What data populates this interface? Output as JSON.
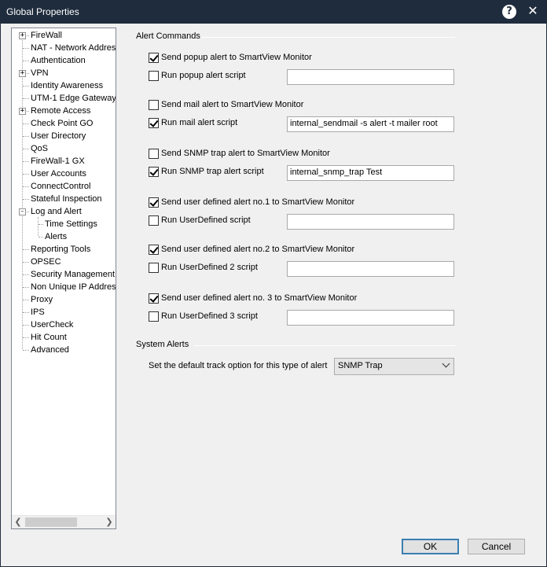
{
  "window": {
    "title": "Global Properties"
  },
  "tree": {
    "items": [
      {
        "label": "FireWall",
        "expander": "+"
      },
      {
        "label": "NAT - Network Address Translation",
        "expander": ""
      },
      {
        "label": "Authentication",
        "expander": ""
      },
      {
        "label": "VPN",
        "expander": "+"
      },
      {
        "label": "Identity Awareness",
        "expander": ""
      },
      {
        "label": "UTM-1 Edge Gateway",
        "expander": ""
      },
      {
        "label": "Remote Access",
        "expander": "+"
      },
      {
        "label": "Check Point GO",
        "expander": ""
      },
      {
        "label": "User Directory",
        "expander": ""
      },
      {
        "label": "QoS",
        "expander": ""
      },
      {
        "label": "FireWall-1 GX",
        "expander": ""
      },
      {
        "label": "User Accounts",
        "expander": ""
      },
      {
        "label": "ConnectControl",
        "expander": ""
      },
      {
        "label": "Stateful Inspection",
        "expander": ""
      },
      {
        "label": "Log and Alert",
        "expander": "-"
      },
      {
        "label": "Time Settings",
        "expander": ""
      },
      {
        "label": "Alerts",
        "expander": ""
      },
      {
        "label": "Reporting Tools",
        "expander": ""
      },
      {
        "label": "OPSEC",
        "expander": ""
      },
      {
        "label": "Security Management Access",
        "expander": ""
      },
      {
        "label": "Non Unique IP Address Ranges",
        "expander": ""
      },
      {
        "label": "Proxy",
        "expander": ""
      },
      {
        "label": "IPS",
        "expander": ""
      },
      {
        "label": "UserCheck",
        "expander": ""
      },
      {
        "label": "Hit Count",
        "expander": ""
      },
      {
        "label": "Advanced",
        "expander": ""
      }
    ]
  },
  "alert_commands": {
    "header": "Alert Commands",
    "rows": [
      {
        "label": "Send popup alert to SmartView Monitor",
        "checked": true
      },
      {
        "label": "Run popup alert script",
        "checked": false,
        "value": ""
      },
      {
        "label": "Send mail alert to SmartView Monitor",
        "checked": false
      },
      {
        "label": "Run mail alert script",
        "checked": true,
        "value": "internal_sendmail -s alert -t mailer root"
      },
      {
        "label": "Send SNMP trap alert to SmartView Monitor",
        "checked": false
      },
      {
        "label": "Run SNMP trap alert script",
        "checked": true,
        "value": "internal_snmp_trap Test"
      },
      {
        "label": "Send user defined alert no.1 to SmartView Monitor",
        "checked": true
      },
      {
        "label": "Run UserDefined script",
        "checked": false,
        "value": ""
      },
      {
        "label": "Send user defined alert no.2 to SmartView Monitor",
        "checked": true
      },
      {
        "label": "Run UserDefined 2 script",
        "checked": false,
        "value": ""
      },
      {
        "label": "Send user defined alert no. 3 to SmartView Monitor",
        "checked": true
      },
      {
        "label": "Run UserDefined 3 script",
        "checked": false,
        "value": ""
      }
    ]
  },
  "system_alerts": {
    "header": "System Alerts",
    "track_label": "Set the default track option for this type of alert",
    "track_value": "SNMP Trap"
  },
  "buttons": {
    "ok": "OK",
    "cancel": "Cancel"
  }
}
